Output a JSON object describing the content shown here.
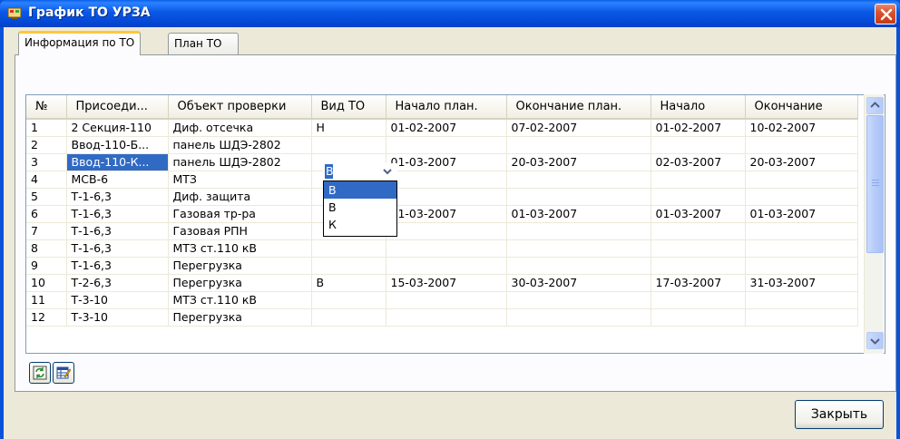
{
  "window": {
    "title": "График ТО УРЗА",
    "close_symbol": "×"
  },
  "tabs": [
    {
      "label": "Информация по ТО",
      "active": true
    },
    {
      "label": "План ТО",
      "active": false
    }
  ],
  "grid": {
    "columns": [
      "№",
      "Присоеди...",
      "Объект проверки",
      "Вид ТО",
      "Начало план.",
      "Окончание план.",
      "Начало",
      "Окончание"
    ],
    "rows": [
      [
        "1",
        "2 Секция-110",
        "Диф. отсечка",
        "Н",
        "01-02-2007",
        "07-02-2007",
        "01-02-2007",
        "10-02-2007"
      ],
      [
        "2",
        "Ввод-110-Б...",
        "панель ШДЭ-2802",
        "",
        "",
        "",
        "",
        ""
      ],
      [
        "3",
        "Ввод-110-К...",
        "панель ШДЭ-2802",
        "",
        "01-03-2007",
        "20-03-2007",
        "02-03-2007",
        "20-03-2007"
      ],
      [
        "4",
        "МСВ-6",
        "МТЗ",
        "",
        "",
        "",
        "",
        ""
      ],
      [
        "5",
        "Т-1-6,3",
        "Диф. защита",
        "",
        "",
        "",
        "",
        ""
      ],
      [
        "6",
        "Т-1-6,3",
        "Газовая тр-ра",
        "",
        "01-03-2007",
        "01-03-2007",
        "01-03-2007",
        "01-03-2007"
      ],
      [
        "7",
        "Т-1-6,3",
        "Газовая РПН",
        "",
        "",
        "",
        "",
        ""
      ],
      [
        "8",
        "Т-1-6,3",
        "МТЗ ст.110 кВ",
        "",
        "",
        "",
        "",
        ""
      ],
      [
        "9",
        "Т-1-6,3",
        "Перегрузка",
        "",
        "",
        "",
        "",
        ""
      ],
      [
        "10",
        "Т-2-6,3",
        "Перегрузка",
        "В",
        "15-03-2007",
        "30-03-2007",
        "17-03-2007",
        "31-03-2007"
      ],
      [
        "11",
        "Т-3-10",
        "МТЗ ст.110 кВ",
        "",
        "",
        "",
        "",
        ""
      ],
      [
        "12",
        "Т-3-10",
        "Перегрузка",
        "",
        "",
        "",
        "",
        ""
      ]
    ],
    "selected_row": 3,
    "editor": {
      "value": "В",
      "options": [
        "В",
        "В",
        "К"
      ],
      "highlighted_option": 0
    }
  },
  "toolbar": {
    "refresh_icon": "refresh-icon",
    "edit_icon": "edit-table-icon"
  },
  "footer": {
    "close_label": "Закрыть"
  },
  "colors": {
    "title_bar": "#0a58e6",
    "selection": "#316ac5",
    "active_tab_accent": "#ffc73c",
    "dialog_bg": "#ece9d8"
  }
}
